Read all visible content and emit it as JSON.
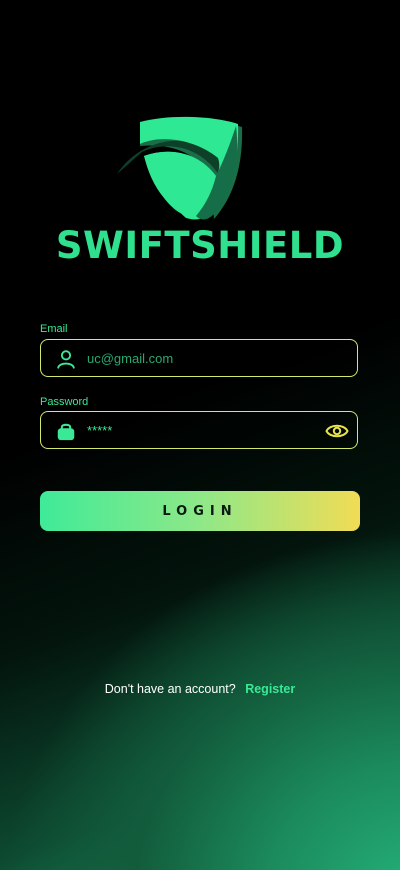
{
  "brand": {
    "name": "SWIFTSHIELD"
  },
  "form": {
    "email": {
      "label": "Email",
      "value": "",
      "placeholder": "uc@gmail.com"
    },
    "password": {
      "label": "Password",
      "value": "*****"
    },
    "login_label": "LOGIN"
  },
  "footer": {
    "question": "Don't have an account?",
    "register_label": "Register"
  },
  "colors": {
    "accent_green": "#2fe08e",
    "accent_yellow": "#f1dc55",
    "field_border": "#d6e86a"
  },
  "icons": {
    "logo": "shield-logo",
    "email": "user-icon",
    "password": "lock-icon",
    "toggle": "eye-icon"
  }
}
